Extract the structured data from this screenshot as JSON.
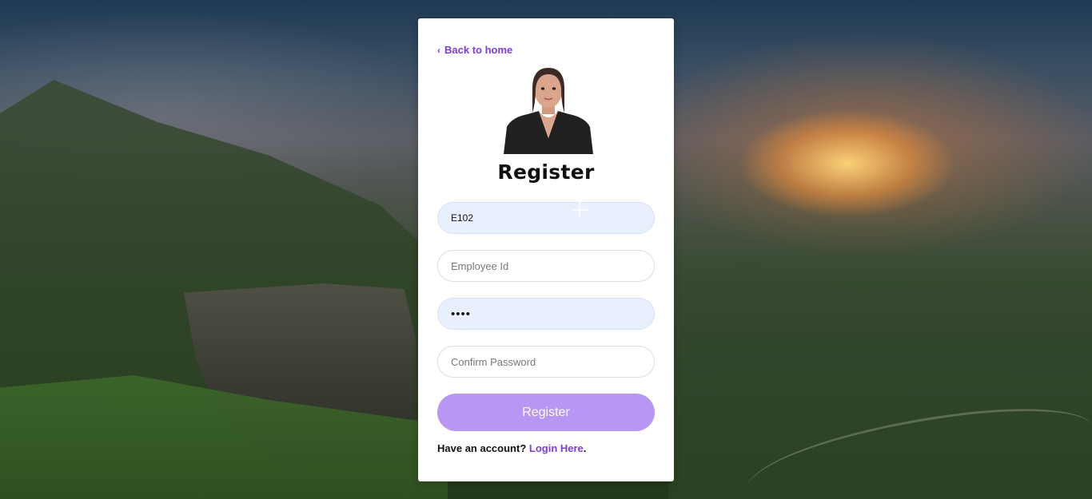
{
  "back_link": {
    "label": "Back to home"
  },
  "form": {
    "title": "Register",
    "fields": [
      {
        "value": "E102",
        "placeholder": ""
      },
      {
        "value": "",
        "placeholder": "Employee Id"
      },
      {
        "value": "••••",
        "placeholder": ""
      },
      {
        "value": "",
        "placeholder": "Confirm Password"
      }
    ],
    "submit_label": "Register"
  },
  "footer": {
    "text": "Have an account?",
    "link": "Login Here",
    "suffix": "."
  },
  "colors": {
    "accent": "#7c3ae0",
    "button": "#b797f3",
    "filled_field": "#e8f0fe"
  },
  "icons": [
    "chevron-left-icon"
  ]
}
